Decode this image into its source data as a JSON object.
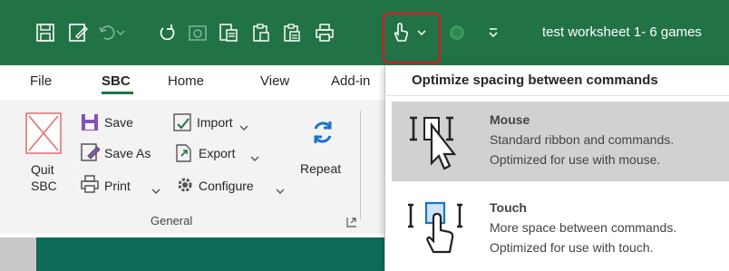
{
  "document_title": "test worksheet 1- 6 games",
  "colors": {
    "accent": "#217346",
    "highlight": "#e81123",
    "sheet": "#0f6a5a"
  },
  "qat": {
    "icons": [
      "save-icon",
      "save-as-icon",
      "undo-icon",
      "redo-icon",
      "camera-icon",
      "paste-special-icon",
      "clipboard-icon",
      "clipboard-alt-icon",
      "print-preview-icon",
      "touch-mouse-mode-icon",
      "chevron-down-icon",
      "record-icon",
      "customize-qat-icon"
    ]
  },
  "tabs": [
    "File",
    "SBC",
    "Home",
    "View",
    "Add-in"
  ],
  "active_tab": "SBC",
  "ribbon": {
    "quit_label": "Quit\nSBC",
    "save_label": "Save",
    "save_as_label": "Save As",
    "print_label": "Print",
    "import_label": "Import",
    "export_label": "Export",
    "configure_label": "Configure",
    "repeat_label": "Repeat",
    "group_label": "General"
  },
  "dropdown": {
    "header": "Optimize spacing between commands",
    "options": [
      {
        "title": "Mouse",
        "line1": "Standard ribbon and commands.",
        "line2": "Optimized for use with mouse.",
        "selected": true
      },
      {
        "title": "Touch",
        "line1": "More space between commands.",
        "line2": "Optimized for use with touch.",
        "selected": false
      }
    ]
  }
}
